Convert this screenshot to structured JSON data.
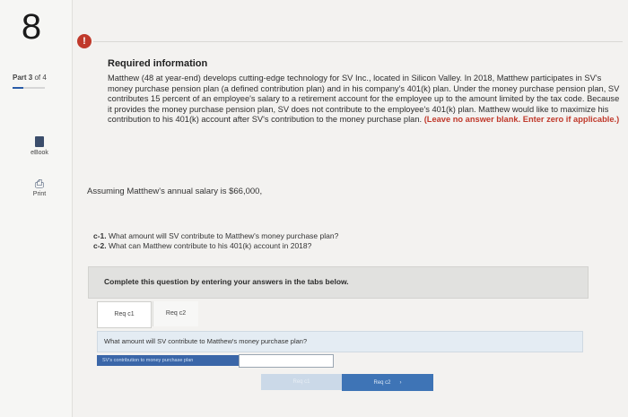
{
  "question_number": "8",
  "part": {
    "label": "Part",
    "current": "3",
    "of_word": "of",
    "total": "4"
  },
  "sidebar_tools": {
    "ebook": "eBook",
    "print": "Print"
  },
  "alert_icon_glyph": "!",
  "required": {
    "title": "Required information",
    "body": "Matthew (48 at year-end) develops cutting-edge technology for SV Inc., located in Silicon Valley. In 2018, Matthew participates in SV's money purchase pension plan (a defined contribution plan) and in his company's 401(k) plan. Under the money purchase pension plan, SV contributes 15 percent of an employee's salary to a retirement account for the employee up to the amount limited by the tax code. Because it provides the money purchase pension plan, SV does not contribute to the employee's 401(k) plan. Matthew would like to maximize his contribution to his 401(k) account after SV's contribution to the money purchase plan.",
    "note": "(Leave no answer blank. Enter zero if applicable.)"
  },
  "assumption": "Assuming Matthew's annual salary is $66,000,",
  "questions": [
    {
      "id": "c-1.",
      "text": "What amount will SV contribute to Matthew's money purchase plan?"
    },
    {
      "id": "c-2.",
      "text": "What can Matthew contribute to his 401(k) account in 2018?"
    }
  ],
  "instruction": "Complete this question by entering your answers in the tabs below.",
  "tabs": [
    "Req c1",
    "Req c2"
  ],
  "active_tab": "Req c1",
  "tab_question": "What amount will SV contribute to Matthew's money purchase plan?",
  "answer_row": {
    "label": "SV's contribution to money purchase plan",
    "value": ""
  },
  "nav": {
    "prev_label": "Req c1",
    "next_label": "Req c2",
    "next_chevron": "›"
  },
  "colors": {
    "accent": "#3e74b6",
    "alert": "#c0392b"
  }
}
